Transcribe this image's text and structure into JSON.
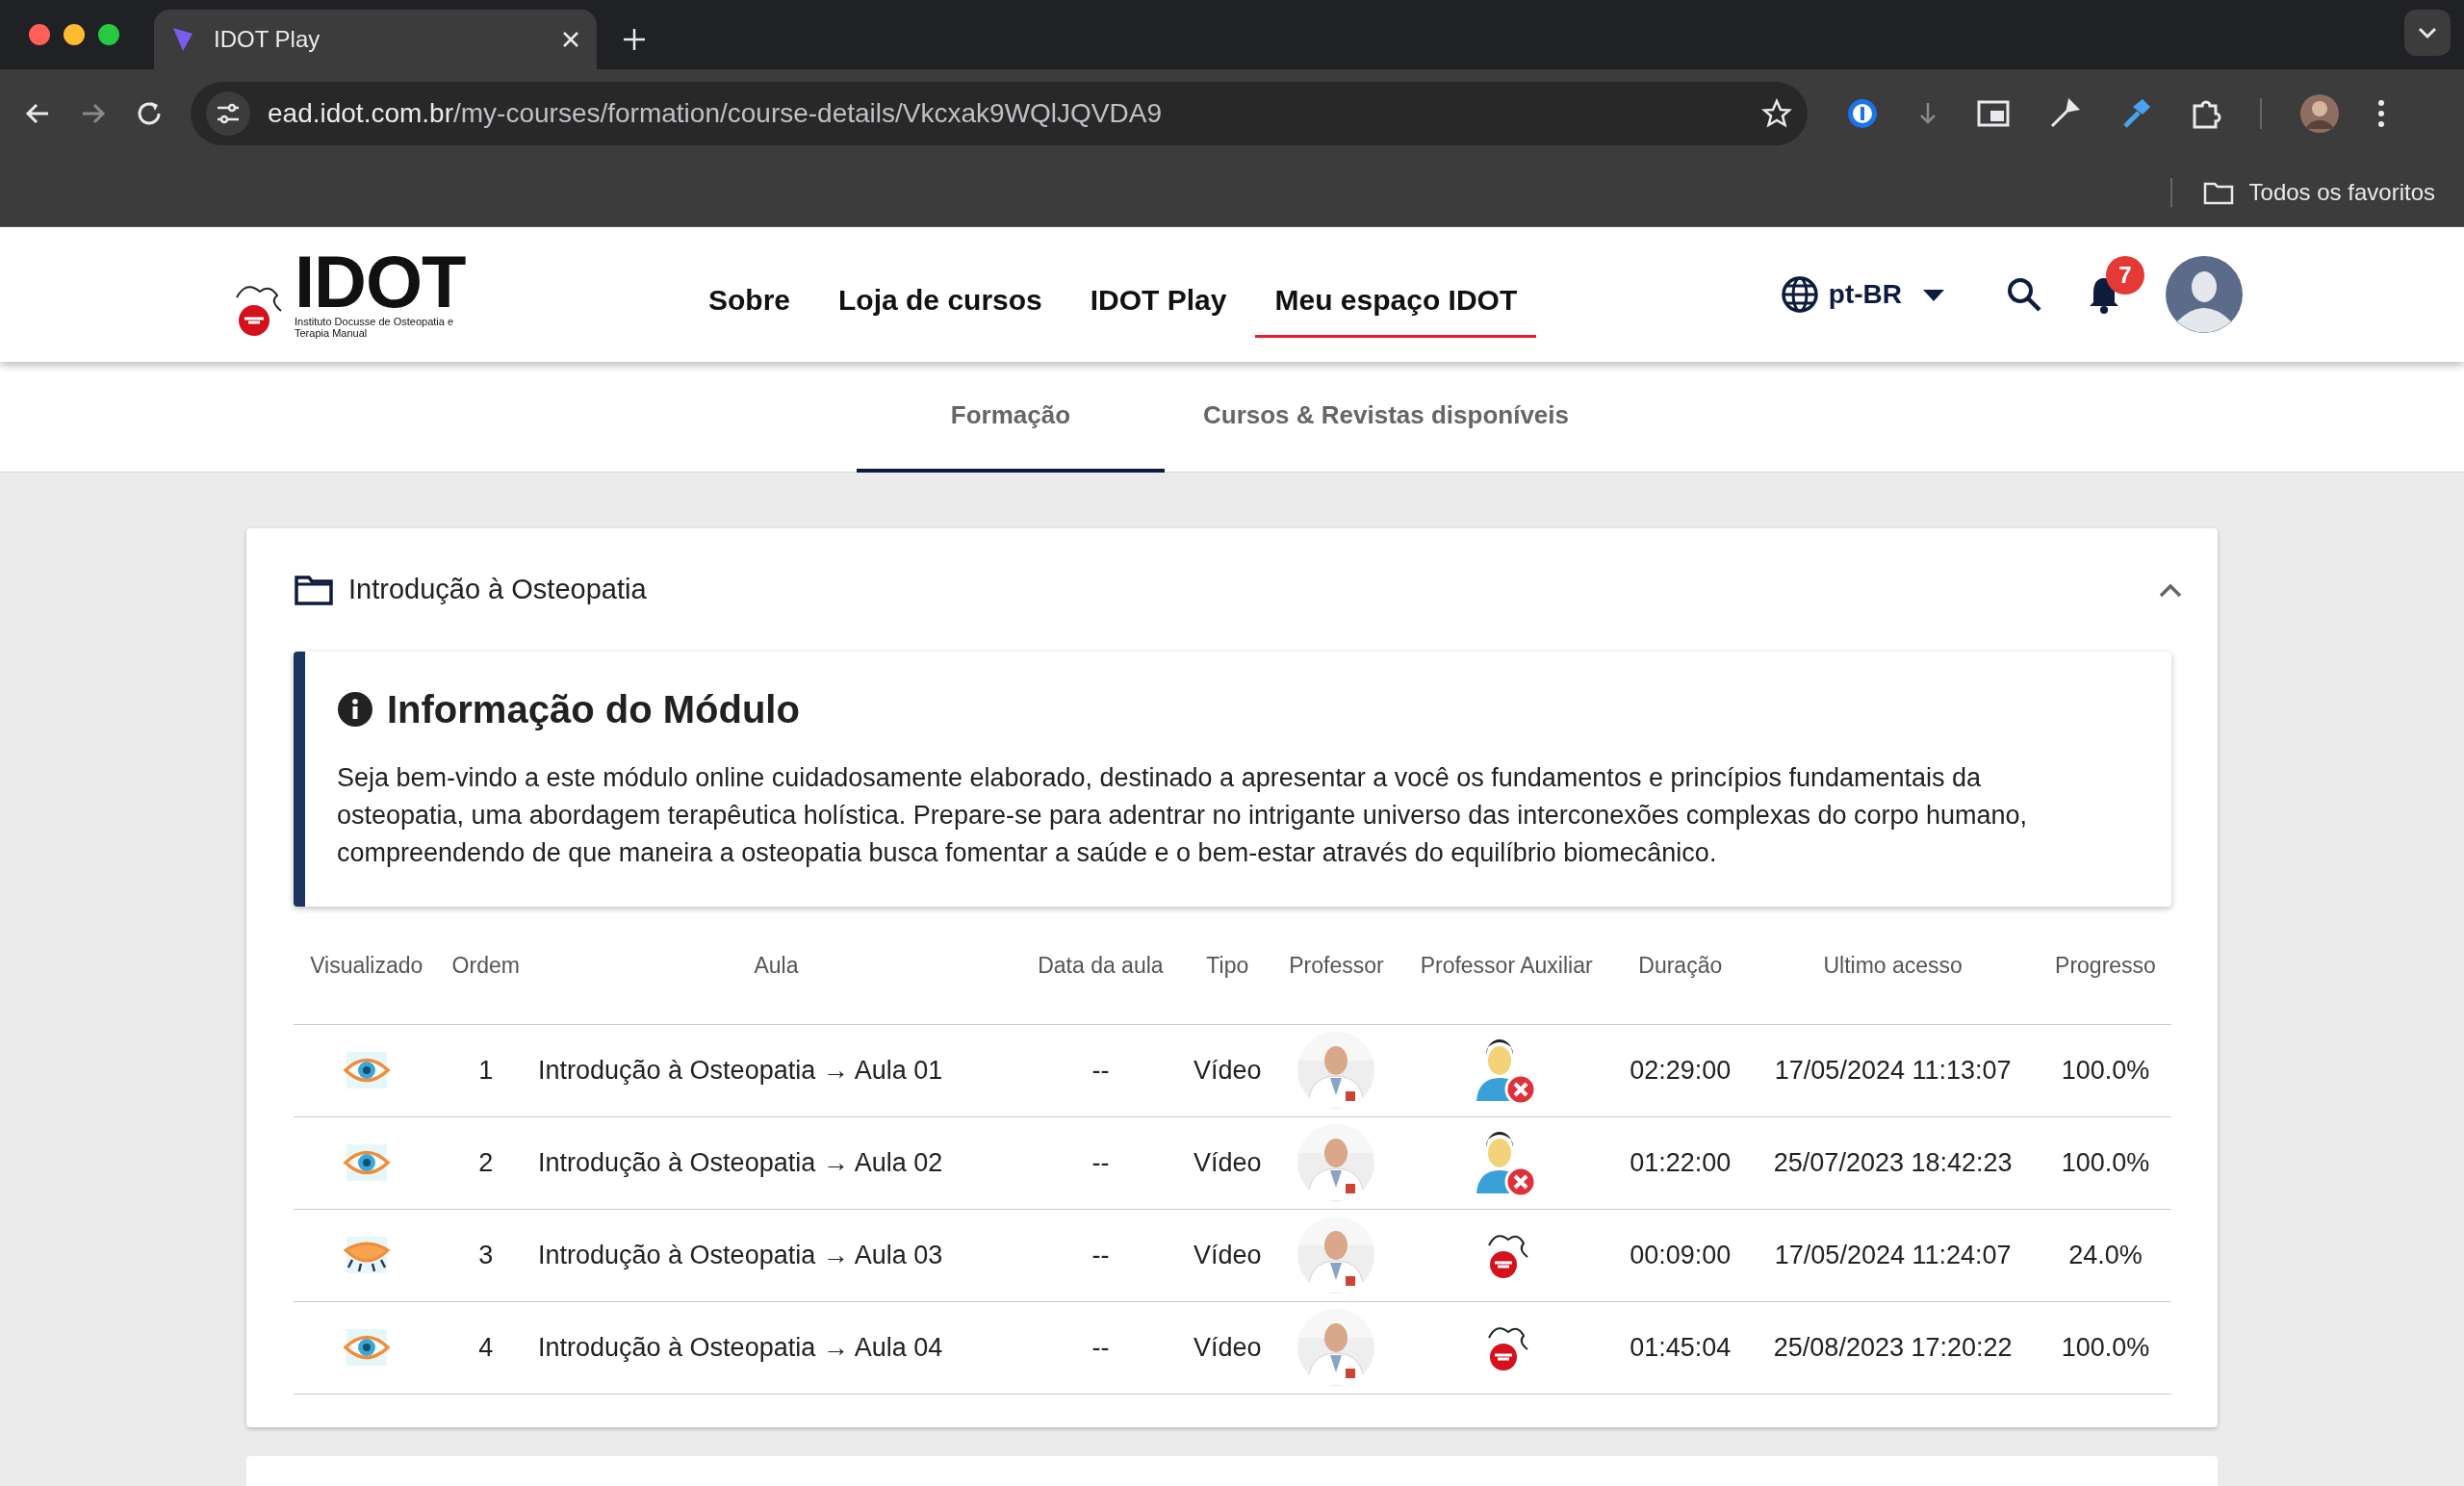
{
  "browser": {
    "tab_title": "IDOT Play",
    "url_host": "ead.idot.com.br",
    "url_path": "/my-courses/formation/course-details/Vkcxak9WQlJQVDA9",
    "bookmark": "Todos os favoritos"
  },
  "header": {
    "logo_text": "IDOT",
    "logo_subtitle": "Instituto Docusse de Osteopatia e Terapia Manual",
    "language": "pt-BR",
    "notification_count": "7",
    "nav": [
      {
        "label": "Sobre",
        "selected": false
      },
      {
        "label": "Loja de cursos",
        "selected": false
      },
      {
        "label": "IDOT Play",
        "selected": false
      },
      {
        "label": "Meu espaço IDOT",
        "selected": true
      }
    ]
  },
  "tabs": [
    {
      "label": "Formação",
      "selected": true
    },
    {
      "label": "Cursos & Revistas disponíveis",
      "selected": false
    }
  ],
  "module": {
    "title": "Introdução à Osteopatia",
    "expanded": true,
    "info_title": "Informação do Módulo",
    "info_text": "Seja bem-vindo a este módulo online cuidadosamente elaborado, destinado a apresentar a você os fundamentos e princípios fundamentais da osteopatia, uma abordagem terapêutica holística. Prepare-se para adentrar no intrigante universo das interconexões complexas do corpo humano, compreendendo de que maneira a osteopatia busca fomentar a saúde e o bem-estar através do equilíbrio biomecânico.",
    "columns": [
      "Visualizado",
      "Ordem",
      "Aula",
      "Data da aula",
      "Tipo",
      "Professor",
      "Professor Auxiliar",
      "Duração",
      "Ultimo acesso",
      "Progresso"
    ],
    "rows": [
      {
        "viewed": true,
        "order": "1",
        "lesson": "Introdução à Osteopatia → Aula 01",
        "date": "--",
        "type": "Vídeo",
        "assistant": {
          "kind": "missing"
        },
        "duration": "02:29:00",
        "last_access": "17/05/2024 11:13:07",
        "progress": "100.0%"
      },
      {
        "viewed": true,
        "order": "2",
        "lesson": "Introdução à Osteopatia → Aula 02",
        "date": "--",
        "type": "Vídeo",
        "assistant": {
          "kind": "missing"
        },
        "duration": "01:22:00",
        "last_access": "25/07/2023 18:42:23",
        "progress": "100.0%"
      },
      {
        "viewed": false,
        "order": "3",
        "lesson": "Introdução à Osteopatia → Aula 03",
        "date": "--",
        "type": "Vídeo",
        "assistant": {
          "kind": "logo"
        },
        "duration": "00:09:00",
        "last_access": "17/05/2024 11:24:07",
        "progress": "24.0%"
      },
      {
        "viewed": true,
        "order": "4",
        "lesson": "Introdução à Osteopatia → Aula 04",
        "date": "--",
        "type": "Vídeo",
        "assistant": {
          "kind": "logo"
        },
        "duration": "01:45:04",
        "last_access": "25/08/2023 17:20:22",
        "progress": "100.0%"
      }
    ]
  }
}
